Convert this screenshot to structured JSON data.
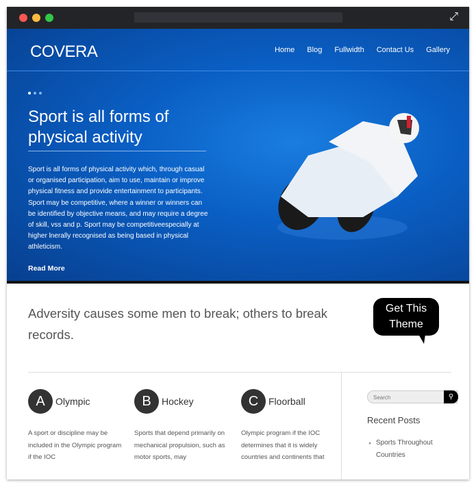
{
  "window": {
    "controls": [
      "close",
      "minimize",
      "maximize"
    ],
    "colors": {
      "close": "#fc5753",
      "minimize": "#fdbc40",
      "maximize": "#33c748"
    },
    "expand_icon": "expand-arrows-icon"
  },
  "header": {
    "logo": "COVERA",
    "nav": [
      "Home",
      "Blog",
      "Fullwidth",
      "Contact Us",
      "Gallery"
    ]
  },
  "hero": {
    "title": "Sport is all forms of physical activity",
    "body": "Sport is all forms of physical activity which, through casual or organised participation, aim to use, maintain or improve physical fitness and provide entertainment to participants. Sport may be competitive, where a winner or winners can be identified by objective means, and may require a degree of skill, vss and p. Sport may be competitiveespecially at higher lnerally recognised as being based in physical athleticism.",
    "read_more": "Read More",
    "slides": 3,
    "active_slide": 1
  },
  "quote": "Adversity causes some men to break; others to break records.",
  "cta": "Get This Theme",
  "features": [
    {
      "letter": "A",
      "title": "Olympic",
      "text": "A sport or discipline may be included in the Olympic program if the IOC"
    },
    {
      "letter": "B",
      "title": "Hockey",
      "text": "Sports that depend primarily on mechanical propulsion, such as motor sports, may"
    },
    {
      "letter": "C",
      "title": "Floorball",
      "text": "Olympic program if the IOC determines that it is widely countries and continents that"
    }
  ],
  "sidebar": {
    "search_placeholder": "Search",
    "recent_title": "Recent Posts",
    "posts": [
      "Sports Throughout Countries"
    ]
  }
}
